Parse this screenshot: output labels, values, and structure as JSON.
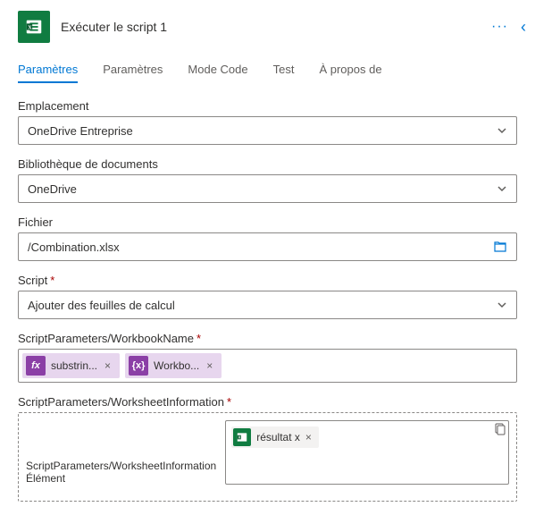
{
  "header": {
    "title": "Exécuter le script 1"
  },
  "tabs": {
    "t0": "Paramètres",
    "t1": "Paramètres",
    "t2": "Mode Code",
    "t3": "Test",
    "t4": "À propos de"
  },
  "fields": {
    "location": {
      "label": "Emplacement",
      "value": "OneDrive Entreprise"
    },
    "library": {
      "label": "Bibliothèque de documents",
      "value": "OneDrive"
    },
    "file": {
      "label": "Fichier",
      "value": "/Combination.xlsx"
    },
    "script": {
      "label": "Script",
      "value": "Ajouter des feuilles de calcul"
    },
    "workbookName": {
      "label": "ScriptParameters/WorkbookName",
      "token1": "substrin...",
      "token2": "Workbo..."
    },
    "worksheetInfo": {
      "label": "ScriptParameters/WorksheetInformation",
      "innerLabel": "ScriptParameters/WorksheetInformation\nÉlément",
      "chip": "résultat x"
    }
  },
  "glyphs": {
    "fx": "fx",
    "braces": "{x}",
    "x": "×"
  }
}
